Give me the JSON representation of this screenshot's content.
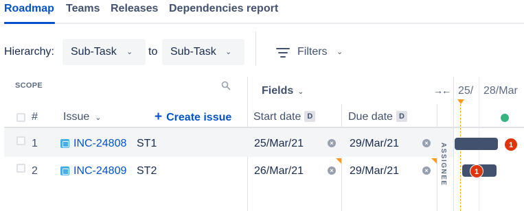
{
  "tabs": [
    {
      "label": "Roadmap",
      "active": true
    },
    {
      "label": "Teams",
      "active": false
    },
    {
      "label": "Releases",
      "active": false
    },
    {
      "label": "Dependencies report",
      "active": false
    }
  ],
  "hierarchy": {
    "label": "Hierarchy:",
    "from_value": "Sub-Task",
    "to_label": "to",
    "to_value": "Sub-Task"
  },
  "filters": {
    "label": "Filters"
  },
  "scope": {
    "title": "SCOPE",
    "search_icon": "search-icon"
  },
  "fields": {
    "label": "Fields"
  },
  "columns": {
    "number": "#",
    "issue": "Issue",
    "create_issue": "Create issue",
    "start_date": "Start date",
    "due_date": "Due date",
    "date_badge": "D",
    "assignee": "ASSIGNEE"
  },
  "timeline": {
    "dates": [
      "25/",
      "28/Mar"
    ]
  },
  "rows": [
    {
      "number": "1",
      "key": "INC-24808",
      "summary": "ST1",
      "start": "25/Mar/21",
      "due": "29/Mar/21",
      "badge_count": "1"
    },
    {
      "number": "2",
      "key": "INC-24809",
      "summary": "ST2",
      "start": "26/Mar/21",
      "due": "29/Mar/21",
      "badge_count": "1"
    }
  ],
  "colors": {
    "accent": "#0052cc",
    "bar": "#42526e",
    "today_marker": "#ff991f",
    "release_dot": "#36b37e",
    "badge": "#de350b"
  }
}
